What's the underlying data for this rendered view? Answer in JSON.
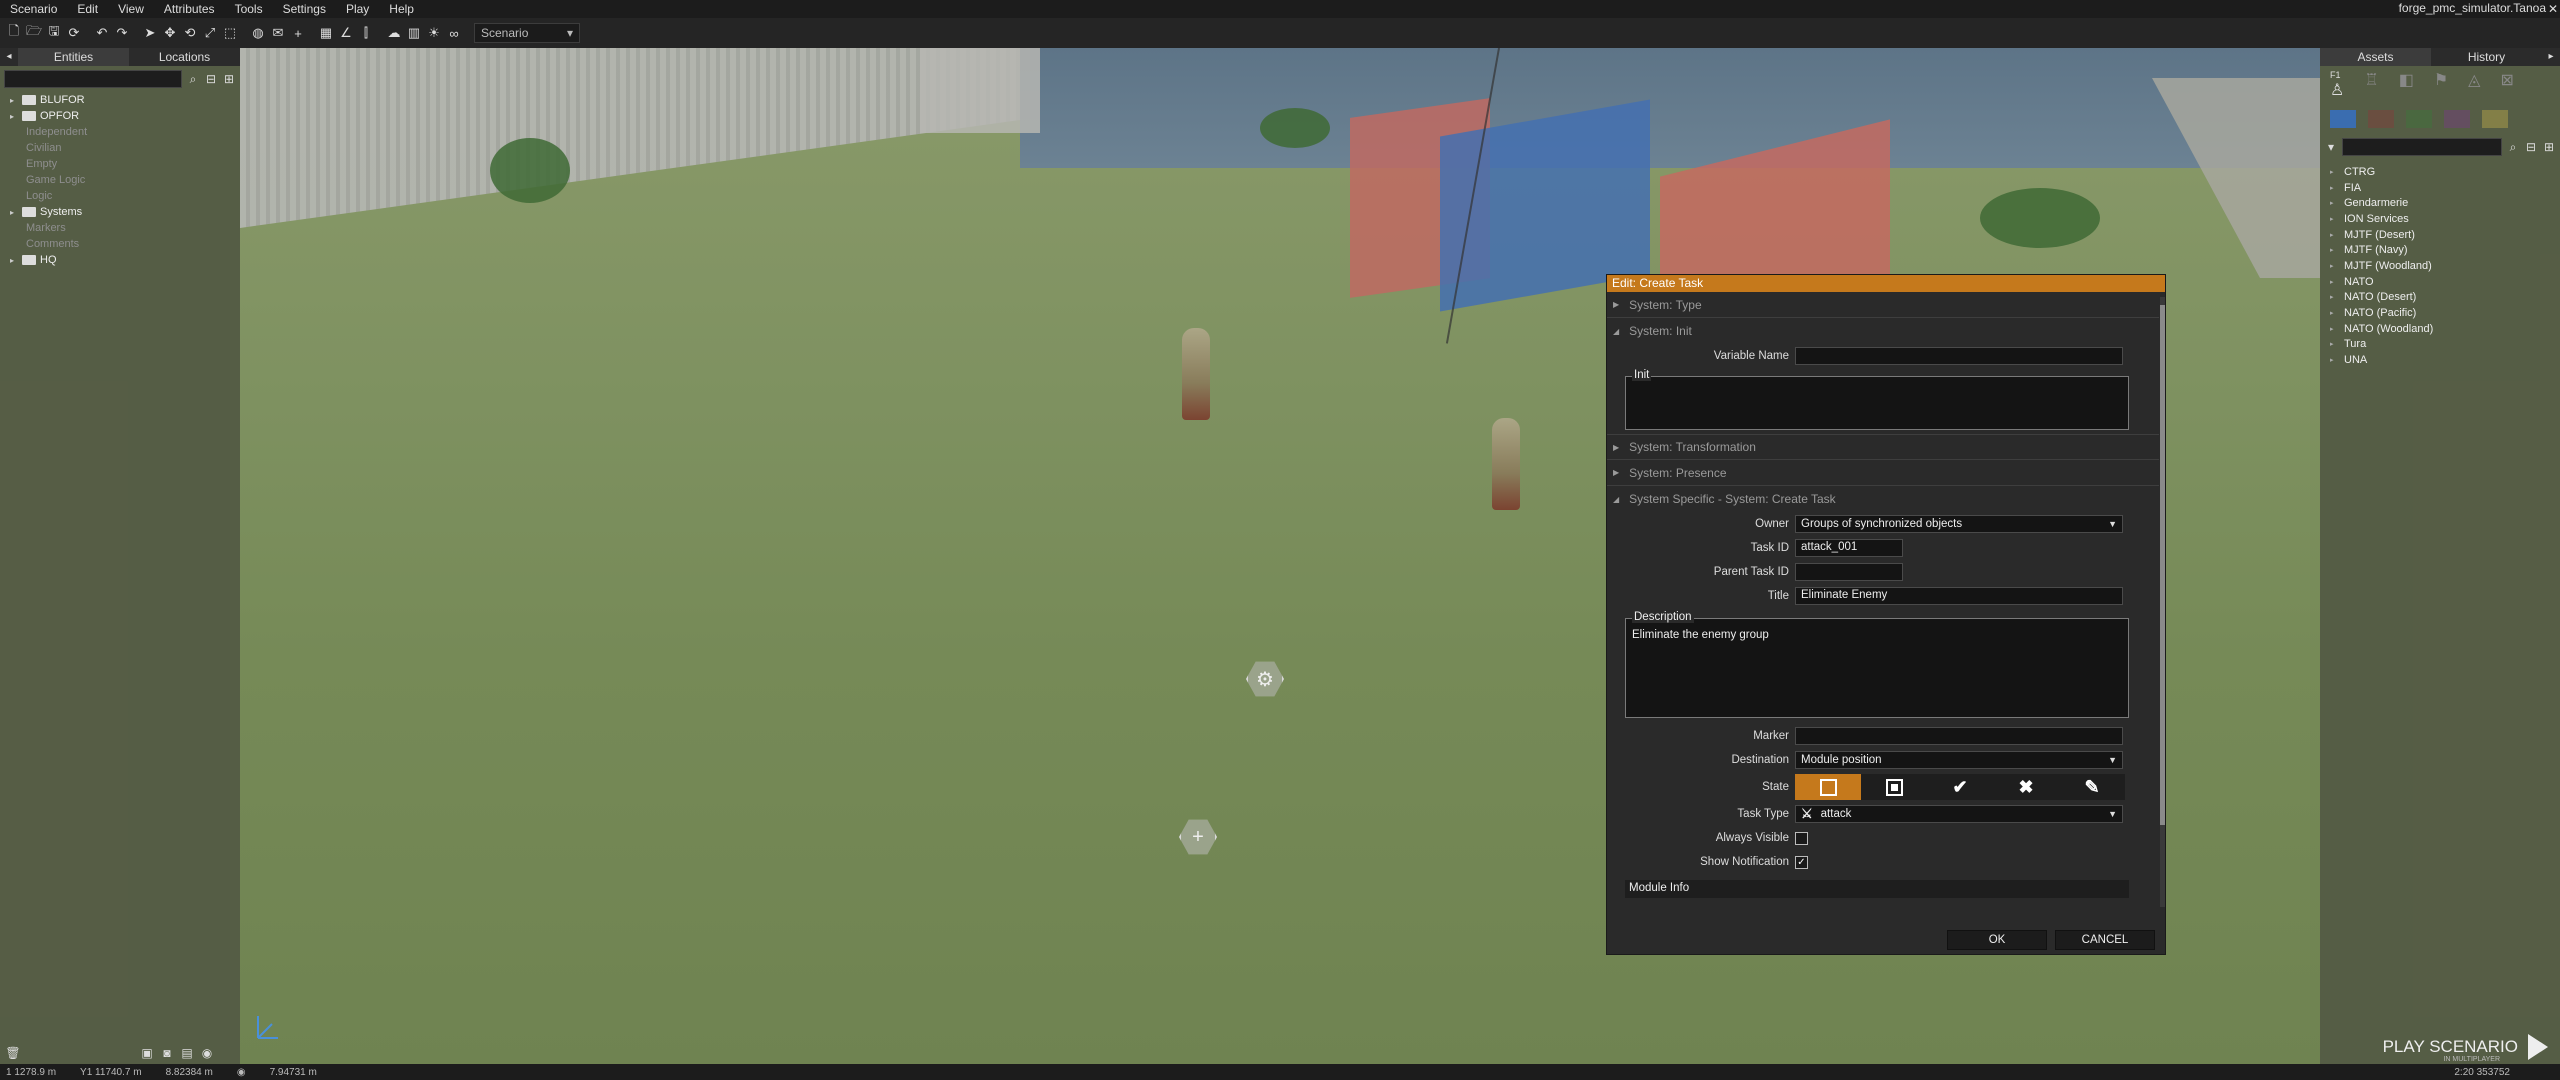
{
  "window": {
    "title": "forge_pmc_simulator.Tanoa"
  },
  "menu": [
    "Scenario",
    "Edit",
    "View",
    "Attributes",
    "Tools",
    "Settings",
    "Play",
    "Help"
  ],
  "toolbar": {
    "mode_select": "Scenario"
  },
  "left_panel": {
    "tabs": [
      "Entities",
      "Locations"
    ],
    "tree": [
      {
        "label": "BLUFOR",
        "dim": false
      },
      {
        "label": "OPFOR",
        "dim": false
      },
      {
        "label": "Independent",
        "dim": true
      },
      {
        "label": "Civilian",
        "dim": true
      },
      {
        "label": "Empty",
        "dim": true
      },
      {
        "label": "Game Logic",
        "dim": true
      },
      {
        "label": "Logic",
        "dim": true
      },
      {
        "label": "Systems",
        "dim": false
      },
      {
        "label": "Markers",
        "dim": true
      },
      {
        "label": "Comments",
        "dim": true
      },
      {
        "label": "HQ",
        "dim": false
      }
    ]
  },
  "right_panel": {
    "tabs": [
      "Assets",
      "History"
    ],
    "first_key": "F1",
    "swatch_colors": [
      "#3a6db0",
      "#8a3a3a",
      "#3a7a3a",
      "#7a3a8a",
      "#c8b44a"
    ],
    "factions": [
      "CTRG",
      "FIA",
      "Gendarmerie",
      "ION Services",
      "MJTF (Desert)",
      "MJTF (Navy)",
      "MJTF (Woodland)",
      "NATO",
      "NATO (Desert)",
      "NATO (Pacific)",
      "NATO (Woodland)",
      "Tura",
      "UNA"
    ]
  },
  "dialog": {
    "title": "Edit: Create Task",
    "sections": {
      "type": "System: Type",
      "init": "System: Init",
      "transformation": "System: Transformation",
      "presence": "System: Presence",
      "specific": "System Specific - System: Create Task"
    },
    "labels": {
      "variable_name": "Variable Name",
      "init": "Init",
      "owner": "Owner",
      "task_id": "Task ID",
      "parent_task_id": "Parent Task ID",
      "title": "Title",
      "description": "Description",
      "marker": "Marker",
      "destination": "Destination",
      "state": "State",
      "task_type": "Task Type",
      "always_visible": "Always Visible",
      "show_notification": "Show Notification"
    },
    "values": {
      "variable_name": "",
      "owner": "Groups of synchronized objects",
      "task_id": "attack_001",
      "parent_task_id": "",
      "title": "Eliminate Enemy",
      "description": "Eliminate the enemy group",
      "marker": "",
      "destination": "Module position",
      "task_type": "attack",
      "always_visible": false,
      "show_notification": true
    },
    "state_options": [
      "created",
      "assigned",
      "succeeded",
      "failed",
      "canceled"
    ],
    "state_selected": "created",
    "module_info": "Module Info",
    "ok": "OK",
    "cancel": "CANCEL"
  },
  "play": {
    "label": "PLAY SCENARIO",
    "sub": "IN MULTIPLAYER"
  },
  "statusbar": {
    "x": "1 1278.9 m",
    "y": "Y1 11740.7 m",
    "z": "8.82384 m",
    "dist": "7.94731 m",
    "time": "2:20 353752"
  },
  "colors": {
    "accent": "#c5791c"
  }
}
